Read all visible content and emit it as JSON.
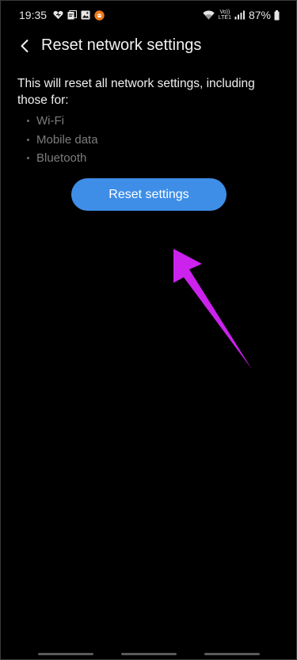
{
  "status_bar": {
    "time": "19:35",
    "battery_percent": "87%",
    "network_label_top": "Vo))",
    "network_label_bottom": "LTE1",
    "left_icons": [
      "heart-icon",
      "alarm-card-icon",
      "gallery-icon",
      "app-notification-icon"
    ],
    "right_icons": [
      "wifi-icon",
      "signal-icon",
      "battery-icon"
    ]
  },
  "header": {
    "back_icon": "chevron-left-icon",
    "title": "Reset network settings"
  },
  "main": {
    "description": "This will reset all network settings, including those for:",
    "items": [
      {
        "label": "Wi-Fi"
      },
      {
        "label": "Mobile data"
      },
      {
        "label": "Bluetooth"
      }
    ],
    "reset_button_label": "Reset settings"
  },
  "colors": {
    "background": "#000000",
    "button": "#3e8ee8",
    "annotation_arrow": "#cc22ee",
    "muted_text": "#7d7d7d"
  }
}
